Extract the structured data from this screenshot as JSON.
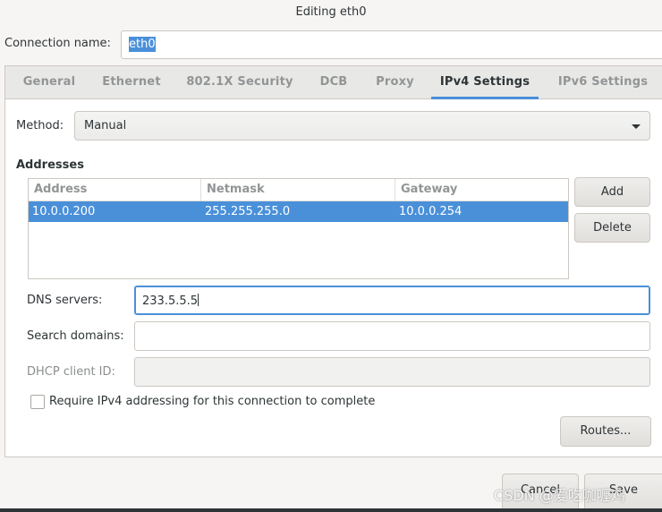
{
  "window": {
    "title": "Editing eth0"
  },
  "connection": {
    "label": "Connection name:",
    "value": "eth0"
  },
  "tabs": [
    {
      "label": "General"
    },
    {
      "label": "Ethernet"
    },
    {
      "label": "802.1X Security"
    },
    {
      "label": "DCB"
    },
    {
      "label": "Proxy"
    },
    {
      "label": "IPv4 Settings",
      "active": true
    },
    {
      "label": "IPv6 Settings"
    }
  ],
  "ipv4": {
    "method_label": "Method:",
    "method_value": "Manual",
    "addresses_heading": "Addresses",
    "columns": [
      "Address",
      "Netmask",
      "Gateway"
    ],
    "rows": [
      {
        "address": "10.0.0.200",
        "netmask": "255.255.255.0",
        "gateway": "10.0.0.254",
        "selected": true
      }
    ],
    "add_label": "Add",
    "delete_label": "Delete",
    "dns_label": "DNS servers:",
    "dns_value": "233.5.5.5",
    "search_label": "Search domains:",
    "search_value": "",
    "dhcp_label": "DHCP client ID:",
    "dhcp_value": "",
    "require_label": "Require IPv4 addressing for this connection to complete",
    "require_checked": false,
    "routes_label": "Routes..."
  },
  "actions": {
    "cancel_label": "Cancel",
    "save_label": "Save"
  },
  "watermark": "CSDN @爱吃咖喱鸡",
  "colors": {
    "accent": "#4a90d9",
    "background": "#f6f5f4"
  }
}
